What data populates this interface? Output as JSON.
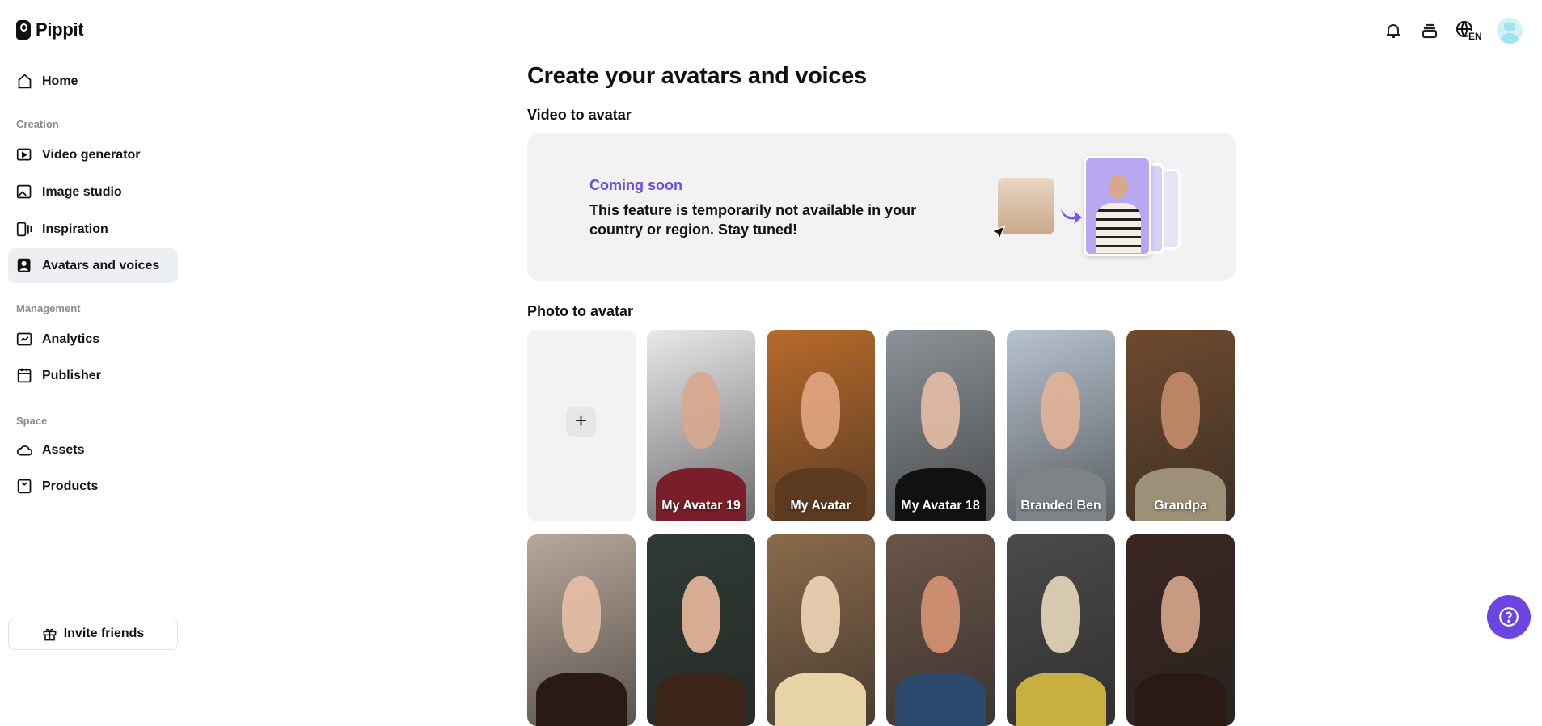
{
  "app": {
    "name": "Pippit"
  },
  "sidebar": {
    "home": "Home",
    "sections": {
      "creation": "Creation",
      "management": "Management",
      "space": "Space"
    },
    "items": {
      "video_generator": "Video generator",
      "image_studio": "Image studio",
      "inspiration": "Inspiration",
      "avatars_voices": "Avatars and voices",
      "analytics": "Analytics",
      "publisher": "Publisher",
      "assets": "Assets",
      "products": "Products"
    },
    "invite": "Invite friends"
  },
  "header": {
    "language": "EN"
  },
  "main": {
    "title": "Create your avatars and voices",
    "video_section": "Video to avatar",
    "banner": {
      "status": "Coming soon",
      "message": "This feature is temporarily not available in your country or region. Stay tuned!"
    },
    "photo_section": "Photo to avatar",
    "add_label": "+",
    "avatars": [
      {
        "name": "My Avatar 19",
        "bg": "#e9e9ec",
        "skin": "#d9a78e",
        "cloth": "#7a1e2a"
      },
      {
        "name": "My Avatar",
        "bg": "#b86a2a",
        "skin": "#e1a583",
        "cloth": "#5b3a20"
      },
      {
        "name": "My Avatar 18",
        "bg": "#8c9297",
        "skin": "#e6bca6",
        "cloth": "#111"
      },
      {
        "name": "Branded Ben",
        "bg": "#b7c3cf",
        "skin": "#e2b298",
        "cloth": "#7e8387"
      },
      {
        "name": "Grandpa",
        "bg": "#6e4a2e",
        "skin": "#c58d6c",
        "cloth": "#9c9078"
      },
      {
        "name": "",
        "bg": "#b8a79a",
        "skin": "#e8bfa5",
        "cloth": "#2a1a14"
      },
      {
        "name": "",
        "bg": "#2f3a33",
        "skin": "#eab99e",
        "cloth": "#3a2518"
      },
      {
        "name": "",
        "bg": "#8a6a4a",
        "skin": "#f1d6b8",
        "cloth": "#e8d4a8"
      },
      {
        "name": "",
        "bg": "#6a5448",
        "skin": "#d89574",
        "cloth": "#2c4a6e"
      },
      {
        "name": "",
        "bg": "#4a4a4a",
        "skin": "#e8d8bc",
        "cloth": "#c8b040"
      },
      {
        "name": "",
        "bg": "#3a2620",
        "skin": "#d7a88c",
        "cloth": "#2a1a14"
      }
    ]
  },
  "colors": {
    "accent": "#6a45e0",
    "active_bg": "#ecf0f3",
    "banner_bg": "#f2f2f2"
  }
}
